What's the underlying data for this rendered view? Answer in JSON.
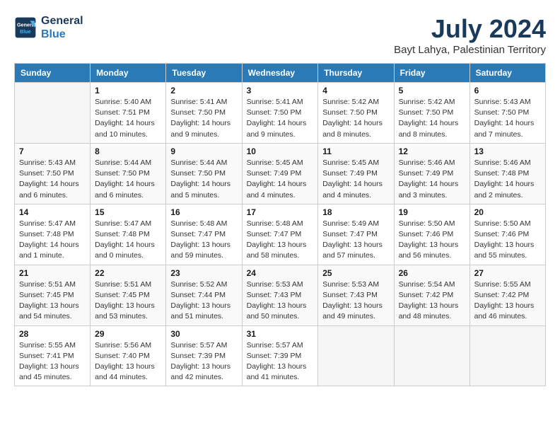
{
  "logo": {
    "line1": "General",
    "line2": "Blue"
  },
  "title": "July 2024",
  "location": "Bayt Lahya, Palestinian Territory",
  "headers": [
    "Sunday",
    "Monday",
    "Tuesday",
    "Wednesday",
    "Thursday",
    "Friday",
    "Saturday"
  ],
  "weeks": [
    [
      {
        "day": "",
        "info": ""
      },
      {
        "day": "1",
        "info": "Sunrise: 5:40 AM\nSunset: 7:51 PM\nDaylight: 14 hours\nand 10 minutes."
      },
      {
        "day": "2",
        "info": "Sunrise: 5:41 AM\nSunset: 7:50 PM\nDaylight: 14 hours\nand 9 minutes."
      },
      {
        "day": "3",
        "info": "Sunrise: 5:41 AM\nSunset: 7:50 PM\nDaylight: 14 hours\nand 9 minutes."
      },
      {
        "day": "4",
        "info": "Sunrise: 5:42 AM\nSunset: 7:50 PM\nDaylight: 14 hours\nand 8 minutes."
      },
      {
        "day": "5",
        "info": "Sunrise: 5:42 AM\nSunset: 7:50 PM\nDaylight: 14 hours\nand 8 minutes."
      },
      {
        "day": "6",
        "info": "Sunrise: 5:43 AM\nSunset: 7:50 PM\nDaylight: 14 hours\nand 7 minutes."
      }
    ],
    [
      {
        "day": "7",
        "info": "Sunrise: 5:43 AM\nSunset: 7:50 PM\nDaylight: 14 hours\nand 6 minutes."
      },
      {
        "day": "8",
        "info": "Sunrise: 5:44 AM\nSunset: 7:50 PM\nDaylight: 14 hours\nand 6 minutes."
      },
      {
        "day": "9",
        "info": "Sunrise: 5:44 AM\nSunset: 7:50 PM\nDaylight: 14 hours\nand 5 minutes."
      },
      {
        "day": "10",
        "info": "Sunrise: 5:45 AM\nSunset: 7:49 PM\nDaylight: 14 hours\nand 4 minutes."
      },
      {
        "day": "11",
        "info": "Sunrise: 5:45 AM\nSunset: 7:49 PM\nDaylight: 14 hours\nand 4 minutes."
      },
      {
        "day": "12",
        "info": "Sunrise: 5:46 AM\nSunset: 7:49 PM\nDaylight: 14 hours\nand 3 minutes."
      },
      {
        "day": "13",
        "info": "Sunrise: 5:46 AM\nSunset: 7:48 PM\nDaylight: 14 hours\nand 2 minutes."
      }
    ],
    [
      {
        "day": "14",
        "info": "Sunrise: 5:47 AM\nSunset: 7:48 PM\nDaylight: 14 hours\nand 1 minute."
      },
      {
        "day": "15",
        "info": "Sunrise: 5:47 AM\nSunset: 7:48 PM\nDaylight: 14 hours\nand 0 minutes."
      },
      {
        "day": "16",
        "info": "Sunrise: 5:48 AM\nSunset: 7:47 PM\nDaylight: 13 hours\nand 59 minutes."
      },
      {
        "day": "17",
        "info": "Sunrise: 5:48 AM\nSunset: 7:47 PM\nDaylight: 13 hours\nand 58 minutes."
      },
      {
        "day": "18",
        "info": "Sunrise: 5:49 AM\nSunset: 7:47 PM\nDaylight: 13 hours\nand 57 minutes."
      },
      {
        "day": "19",
        "info": "Sunrise: 5:50 AM\nSunset: 7:46 PM\nDaylight: 13 hours\nand 56 minutes."
      },
      {
        "day": "20",
        "info": "Sunrise: 5:50 AM\nSunset: 7:46 PM\nDaylight: 13 hours\nand 55 minutes."
      }
    ],
    [
      {
        "day": "21",
        "info": "Sunrise: 5:51 AM\nSunset: 7:45 PM\nDaylight: 13 hours\nand 54 minutes."
      },
      {
        "day": "22",
        "info": "Sunrise: 5:51 AM\nSunset: 7:45 PM\nDaylight: 13 hours\nand 53 minutes."
      },
      {
        "day": "23",
        "info": "Sunrise: 5:52 AM\nSunset: 7:44 PM\nDaylight: 13 hours\nand 51 minutes."
      },
      {
        "day": "24",
        "info": "Sunrise: 5:53 AM\nSunset: 7:43 PM\nDaylight: 13 hours\nand 50 minutes."
      },
      {
        "day": "25",
        "info": "Sunrise: 5:53 AM\nSunset: 7:43 PM\nDaylight: 13 hours\nand 49 minutes."
      },
      {
        "day": "26",
        "info": "Sunrise: 5:54 AM\nSunset: 7:42 PM\nDaylight: 13 hours\nand 48 minutes."
      },
      {
        "day": "27",
        "info": "Sunrise: 5:55 AM\nSunset: 7:42 PM\nDaylight: 13 hours\nand 46 minutes."
      }
    ],
    [
      {
        "day": "28",
        "info": "Sunrise: 5:55 AM\nSunset: 7:41 PM\nDaylight: 13 hours\nand 45 minutes."
      },
      {
        "day": "29",
        "info": "Sunrise: 5:56 AM\nSunset: 7:40 PM\nDaylight: 13 hours\nand 44 minutes."
      },
      {
        "day": "30",
        "info": "Sunrise: 5:57 AM\nSunset: 7:39 PM\nDaylight: 13 hours\nand 42 minutes."
      },
      {
        "day": "31",
        "info": "Sunrise: 5:57 AM\nSunset: 7:39 PM\nDaylight: 13 hours\nand 41 minutes."
      },
      {
        "day": "",
        "info": ""
      },
      {
        "day": "",
        "info": ""
      },
      {
        "day": "",
        "info": ""
      }
    ]
  ]
}
